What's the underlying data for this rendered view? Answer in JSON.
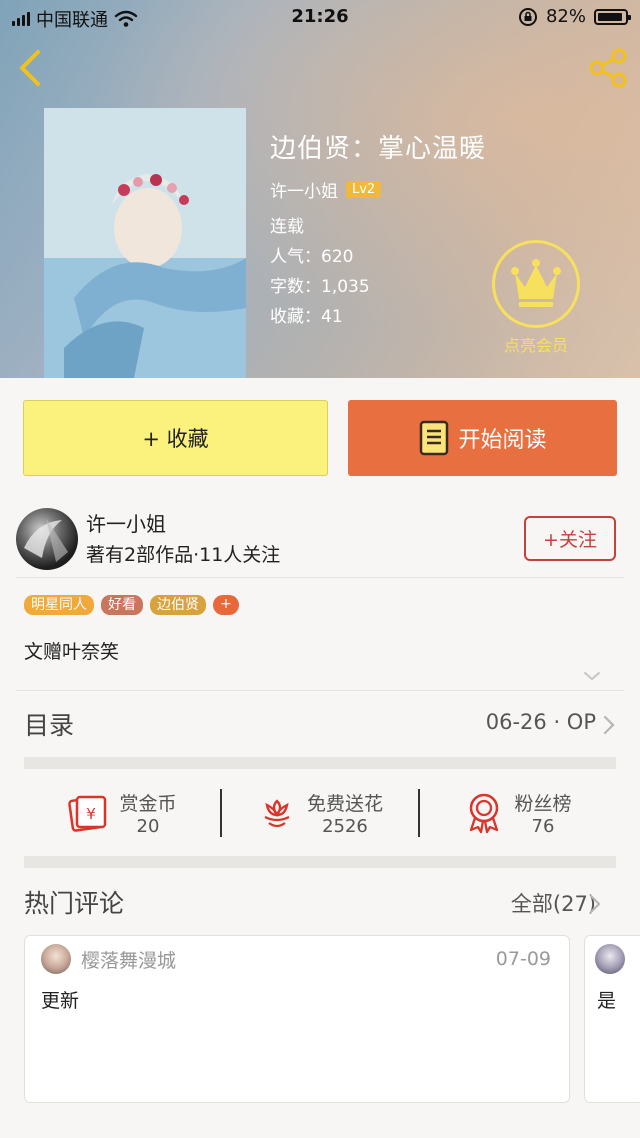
{
  "status_bar": {
    "carrier": "中国联通",
    "time": "21:26",
    "battery": "82%"
  },
  "book": {
    "title": "边伯贤：掌心温暖",
    "author": "许一小姐",
    "level": "Lv2",
    "status": "连载",
    "popularity": "人气：620",
    "word_count": "字数：1,035",
    "favorites": "收藏：41"
  },
  "vip": {
    "label": "点亮会员"
  },
  "actions": {
    "collect_label": "+ 收藏",
    "read_label": "开始阅读"
  },
  "author_card": {
    "name": "许一小姐",
    "stats": "著有2部作品·11人关注",
    "follow_label": "+关注"
  },
  "tags": [
    {
      "label": "明星同人",
      "color": "#f1a93b"
    },
    {
      "label": "好看",
      "color": "#c8765d"
    },
    {
      "label": "边伯贤",
      "color": "#d8a23f"
    }
  ],
  "tag_add_label": "+",
  "intro": "文赠叶奈笑",
  "toc": {
    "title": "目录",
    "latest": "06-26 · OP"
  },
  "stats": [
    {
      "label": "赏金币",
      "value": "20",
      "icon": "red-envelope-icon"
    },
    {
      "label": "免费送花",
      "value": "2526",
      "icon": "flower-icon"
    },
    {
      "label": "粉丝榜",
      "value": "76",
      "icon": "medal-icon"
    }
  ],
  "hot_comments": {
    "title": "热门评论",
    "all_label": "全部(27)",
    "items": [
      {
        "user": "樱落舞漫城",
        "date": "07-09",
        "body": "更新"
      },
      {
        "body": "是"
      }
    ]
  },
  "colors": {
    "accent_orange": "#e86f3f",
    "collect_yellow": "#fbf27d",
    "follow_red": "#c8403d",
    "vip_gold": "#f6e05e",
    "level_badge": "#f0b93a"
  }
}
